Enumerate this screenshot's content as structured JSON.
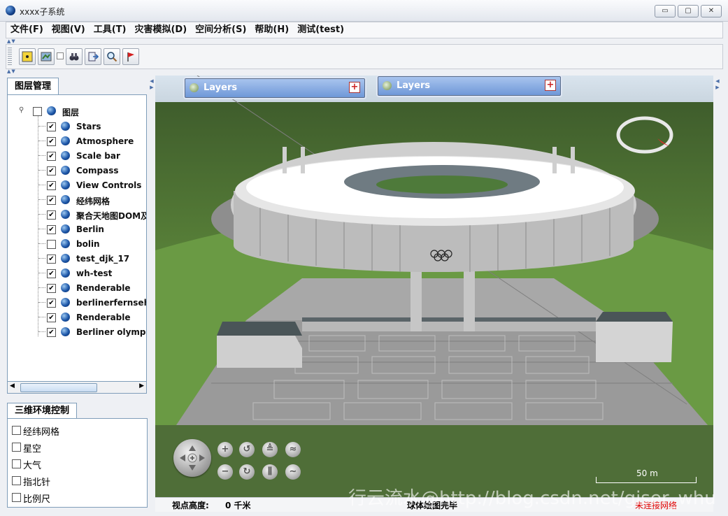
{
  "window": {
    "title": "xxxx子系统",
    "minimize": "▭",
    "maximize": "▢",
    "close": "✕"
  },
  "menu": [
    "文件(F)",
    "视图(V)",
    "工具(T)",
    "灾害模拟(D)",
    "空间分析(S)",
    "帮助(H)",
    "测试(test)"
  ],
  "toolbar": {
    "icons": [
      "select-icon",
      "map-icon",
      "binoculars-icon",
      "export-icon",
      "zoom-icon",
      "flag-icon"
    ]
  },
  "layer_panel": {
    "tab": "图层管理",
    "root": {
      "label": "图层",
      "checked": false
    },
    "layers": [
      {
        "label": "Stars",
        "checked": true
      },
      {
        "label": "Atmosphere",
        "checked": true
      },
      {
        "label": "Scale bar",
        "checked": true
      },
      {
        "label": "Compass",
        "checked": true
      },
      {
        "label": "View Controls",
        "checked": true
      },
      {
        "label": "经纬网格",
        "checked": true
      },
      {
        "label": "聚合天地图DOM及",
        "checked": true
      },
      {
        "label": "Berlin",
        "checked": true
      },
      {
        "label": "bolin",
        "checked": false
      },
      {
        "label": "test_djk_17",
        "checked": true
      },
      {
        "label": "wh-test",
        "checked": true
      },
      {
        "label": "Renderable",
        "checked": true
      },
      {
        "label": "berlinerfernsehtu",
        "checked": true
      },
      {
        "label": "Renderable",
        "checked": true
      },
      {
        "label": "Berliner olympias",
        "checked": true
      }
    ]
  },
  "env_panel": {
    "tab": "三维环境控制",
    "options": [
      {
        "label": "经纬网格",
        "checked": false
      },
      {
        "label": "星空",
        "checked": false
      },
      {
        "label": "大气",
        "checked": false
      },
      {
        "label": "指北针",
        "checked": false
      },
      {
        "label": "比例尺",
        "checked": false
      }
    ]
  },
  "map": {
    "layers_panels": [
      "Layers",
      "Layers"
    ],
    "scale_label": "50 m",
    "status": {
      "altitude_label": "视点高度:",
      "altitude_value": "0 千米",
      "loading": "球体绘图完毕",
      "network": "未连接网络"
    },
    "watermark": "行云流水@http://blog.csdn.net/giser_whu"
  }
}
